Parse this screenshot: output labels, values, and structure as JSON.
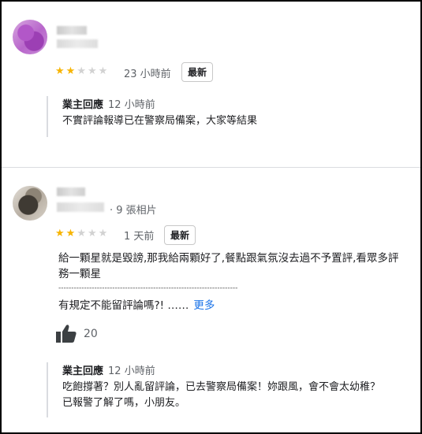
{
  "review1": {
    "rating": 2,
    "time": "23 小時前",
    "badge": "最新",
    "reply": {
      "owner_label": "業主回應",
      "time": "12 小時前",
      "text": "不實評論報導已在警察局備案，大家等結果"
    }
  },
  "review2": {
    "photos": "· 9 張相片",
    "rating": 2,
    "time": "1 天前",
    "badge": "最新",
    "text_line1": "給一顆星就是毀謗,那我給兩顆好了,餐點跟氣氛沒去過不予置評,看眾多評",
    "text_line2": "務一顆星",
    "separator": "----------------------------------------------------------------------",
    "question": "有規定不能留評論嗎?! ……",
    "more": "更多",
    "likes": "20",
    "reply": {
      "owner_label": "業主回應",
      "time": "12 小時前",
      "text": "吃飽撐著？別人亂留評論，已去警察局備案！妳跟風，會不會太幼稚？\n已報警了解了嗎，小朋友。"
    }
  },
  "colors": {
    "star_on": "#f7b400",
    "star_off": "#d2d2d2",
    "link": "#1a73e8"
  },
  "icons": {
    "star": "star-icon",
    "thumb": "thumbs-up-icon"
  }
}
